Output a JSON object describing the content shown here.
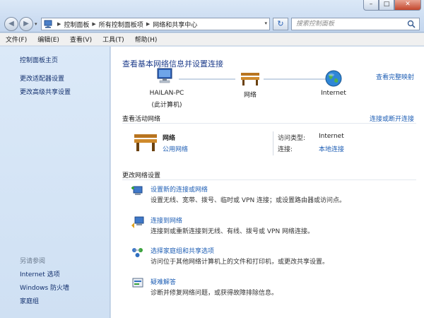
{
  "window": {
    "minimize": "–",
    "maximize": "□",
    "close": "✕"
  },
  "nav": {
    "back": "◀",
    "forward": "▶",
    "dropdown": "▾"
  },
  "address": {
    "crumbs": [
      "控制面板",
      "所有控制面板项",
      "网络和共享中心"
    ],
    "separator": "▶",
    "dropdown": "▾",
    "refresh": "↻"
  },
  "search": {
    "placeholder": "搜索控制面板"
  },
  "menu": [
    "文件(F)",
    "编辑(E)",
    "查看(V)",
    "工具(T)",
    "帮助(H)"
  ],
  "help": "?",
  "sidebar": {
    "links": [
      "控制面板主页",
      "更改适配器设置",
      "更改高级共享设置"
    ],
    "see_also_title": "另请参阅",
    "see_also": [
      "Internet 选项",
      "Windows 防火墙",
      "家庭组"
    ]
  },
  "main": {
    "title": "查看基本网络信息并设置连接",
    "full_map_link": "查看完整映射",
    "map": {
      "computer_name": "HAILAN-PC",
      "computer_sub": "(此计算机)",
      "network": "网络",
      "internet": "Internet"
    },
    "active_section": "查看活动网络",
    "connect_link": "连接或断开连接",
    "active_network": {
      "name": "网络",
      "type": "公用网络",
      "access_label": "访问类型:",
      "access_value": "Internet",
      "conn_label": "连接:",
      "conn_value": "本地连接"
    },
    "settings_section": "更改网络设置",
    "tasks": [
      {
        "title": "设置新的连接或网络",
        "desc": "设置无线、宽带、拨号、临时或 VPN 连接；或设置路由器或访问点。"
      },
      {
        "title": "连接到网络",
        "desc": "连接到或重新连接到无线、有线、拨号或 VPN 网络连接。"
      },
      {
        "title": "选择家庭组和共享选项",
        "desc": "访问位于其他网络计算机上的文件和打印机，或更改共享设置。"
      },
      {
        "title": "疑难解答",
        "desc": "诊断并修复网络问题，或获得故障排除信息。"
      }
    ]
  },
  "colors": {
    "link": "#1f5fb5",
    "title": "#1e3d8b",
    "sidebar_bg": "#d6e6f7",
    "accent_close": "#c3472d"
  }
}
